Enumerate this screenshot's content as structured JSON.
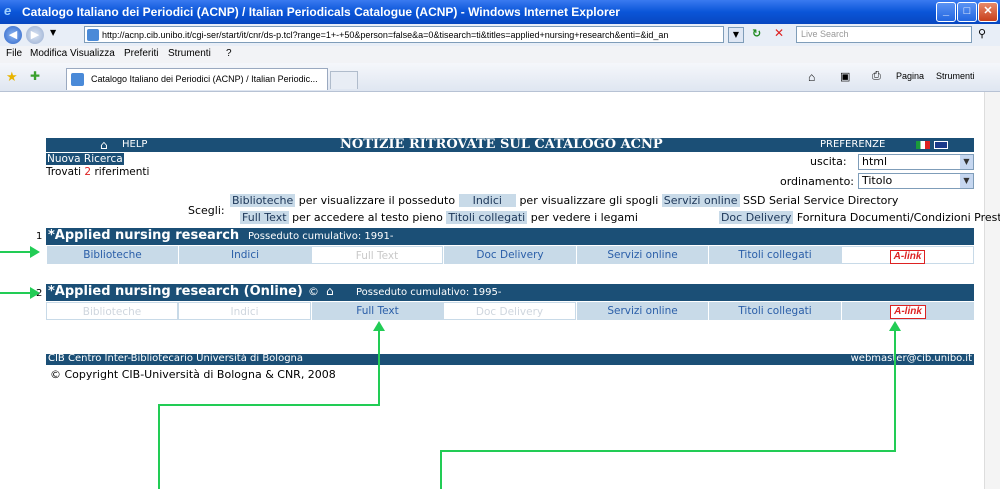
{
  "window": {
    "title": "Catalogo Italiano dei Periodici (ACNP) / Italian Periodicals Catalogue (ACNP) - Windows Internet Explorer",
    "url": "http://acnp.cib.unibo.it/cgi-ser/start/it/cnr/ds-p.tcl?range=1+-+50&person=false&a=0&tisearch=ti&titles=applied+nursing+research&enti=&id_an",
    "search_placeholder": "Live Search",
    "menu": [
      "File",
      "Modifica",
      "Visualizza",
      "Preferiti",
      "Strumenti",
      "?"
    ],
    "tab_title": "Catalogo Italiano dei Periodici (ACNP) / Italian Periodic...",
    "toolbar_page": "Pagina",
    "toolbar_tools": "Strumenti"
  },
  "header": {
    "help": "HELP",
    "title": "NOTIZIE RITROVATE SUL CATALOGO ACNP",
    "preferences": "PREFERENZE"
  },
  "search": {
    "new_search": "Nuova Ricerca",
    "found_prefix": "Trovati",
    "found_count": "2",
    "found_suffix": "riferimenti"
  },
  "options": {
    "output_label": "uscita:",
    "output_value": "html",
    "order_label": "ordinamento:",
    "order_value": "Titolo"
  },
  "legend": {
    "scegli": "Scegli:",
    "b_biblioteche": "Biblioteche",
    "t_biblioteche": "per visualizzare il posseduto",
    "b_indici": "Indici",
    "t_indici": "per visualizzare gli spogli",
    "b_servizi": "Servizi online",
    "t_servizi": "SSD Serial Service Directory",
    "b_fulltext": "Full Text",
    "t_fulltext": "per accedere al testo pieno",
    "b_titoli": "Titoli collegati",
    "t_titoli": "per vedere i legami",
    "b_doc": "Doc Delivery",
    "t_doc": "Fornitura Documenti/Condizioni Prestito"
  },
  "records": [
    {
      "index": "1",
      "title": "*Applied nursing research",
      "holdings": "Posseduto cumulativo: 1991-",
      "buttons": [
        "Biblioteche",
        "Indici",
        "Full Text",
        "Doc Delivery",
        "Servizi online",
        "Titoli collegati",
        "A-link"
      ]
    },
    {
      "index": "2",
      "title": "*Applied nursing research (Online)",
      "holdings": "Posseduto cumulativo: 1995-",
      "buttons": [
        "Biblioteche",
        "Indici",
        "Full Text",
        "Doc Delivery",
        "Servizi online",
        "Titoli collegati",
        "A-link"
      ]
    }
  ],
  "footer": {
    "org": "CIB Centro Inter-Bibliotecario Università di Bologna",
    "email": "webmaster@cib.unibo.it",
    "copyright": "© Copyright CIB-Università di Bologna & CNR, 2008"
  },
  "colors": {
    "header_bg": "#1b4f76",
    "button_bg": "#c8dae8",
    "annotation_arrow": "#22cc55",
    "alink_red": "#dd2222"
  }
}
